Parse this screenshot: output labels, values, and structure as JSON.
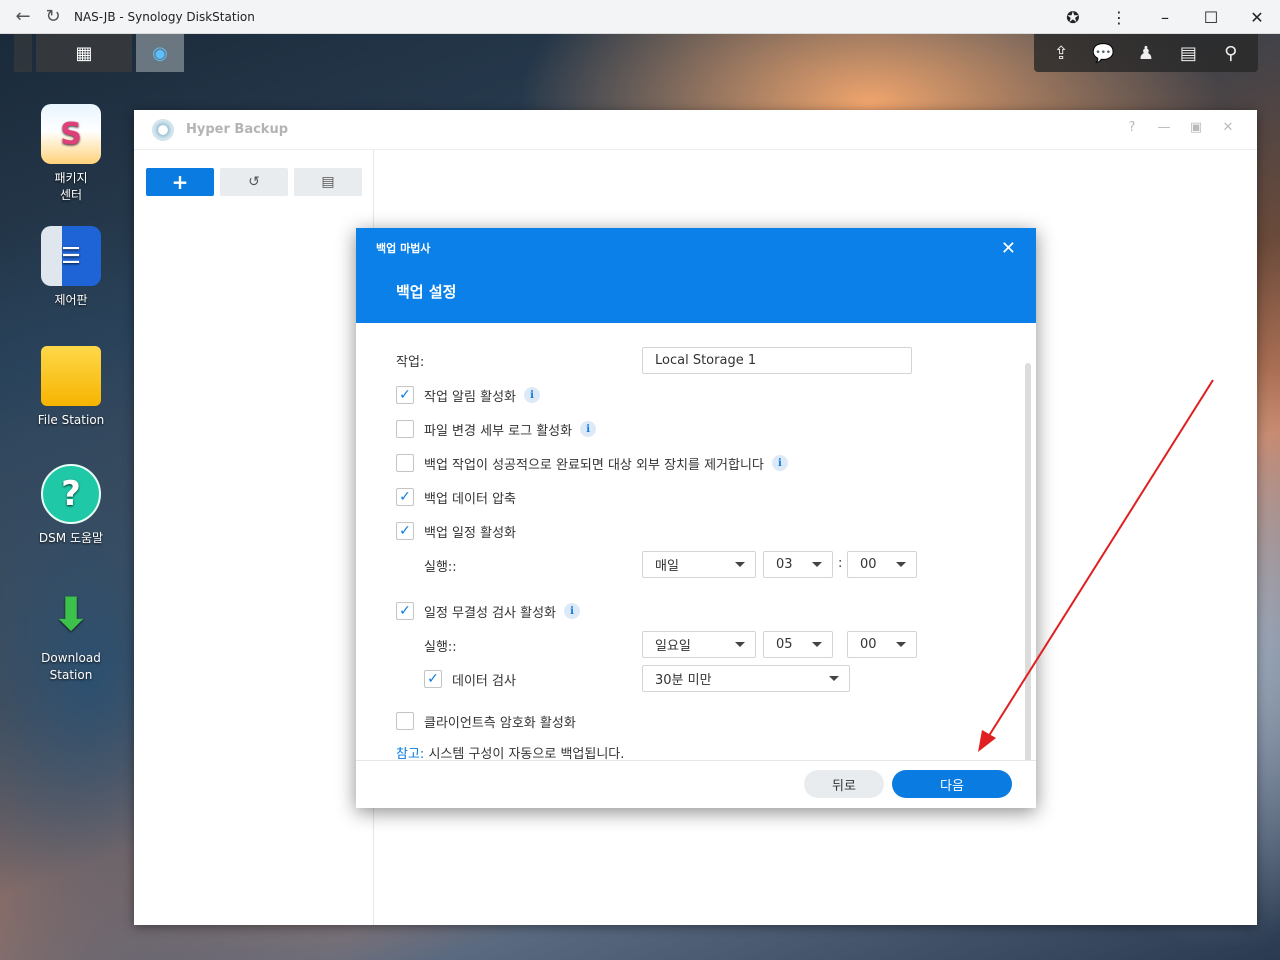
{
  "browser": {
    "title": "NAS-JB - Synology DiskStation"
  },
  "desktop": {
    "icons": [
      {
        "label": "패키지\n센터",
        "line1": "패키지",
        "line2": "센터"
      },
      {
        "label": "제어판"
      },
      {
        "label": "File Station"
      },
      {
        "label": "DSM 도움말"
      },
      {
        "label": "Download Station"
      }
    ]
  },
  "hyper_backup": {
    "title": "Hyper Backup"
  },
  "dialog": {
    "small_title": "백업 마법사",
    "big_title": "백업 설정",
    "task_label": "작업:",
    "task_value": "Local Storage 1",
    "options": {
      "task_notification": "작업 알림 활성화",
      "file_change_log": "파일 변경 세부 로그 활성화",
      "remove_external": "백업 작업이 성공적으로 완료되면 대상 외부 장치를 제거합니다",
      "compress": "백업 데이터 압축",
      "schedule": "백업 일정 활성화",
      "integrity": "일정 무결성 검사 활성화",
      "data_check": "데이터 검사",
      "client_encryption": "클라이언트측 암호화 활성화"
    },
    "schedule": {
      "run_label": "실행::",
      "frequency": "매일",
      "hour": "03",
      "separator": ":",
      "minute": "00"
    },
    "integrity_schedule": {
      "run_label": "실행::",
      "day": "일요일",
      "hour": "05",
      "minute": "00",
      "duration": "30분 미만"
    },
    "note_prefix": "참고:",
    "note_text": " 시스템 구성이 자동으로 백업됩니다.",
    "back_button": "뒤로",
    "next_button": "다음"
  },
  "colors": {
    "accent": "#0a7be0",
    "header": "#0a80e8",
    "annotation_arrow": "#e02020"
  }
}
